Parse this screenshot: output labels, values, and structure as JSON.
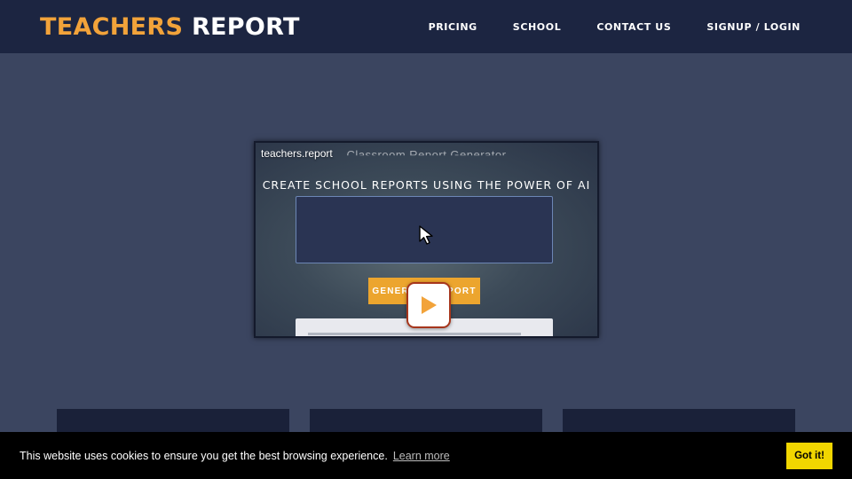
{
  "brand": {
    "part1": "TEACHERS",
    "part2": "REPORT"
  },
  "nav": {
    "items": [
      {
        "label": "PRICING"
      },
      {
        "label": "SCHOOL"
      },
      {
        "label": "CONTACT US"
      },
      {
        "label": "SIGNUP / LOGIN"
      }
    ]
  },
  "video": {
    "title": "teachers.report",
    "heading": "Classroom Report Generator",
    "headline": "CREATE SCHOOL REPORTS USING THE POWER OF AI",
    "button_label": "GENERATE REPORT",
    "icons": [
      "cursor-icon",
      "play-icon"
    ]
  },
  "cookie": {
    "message": "This website uses cookies to ensure you get the best browsing experience.",
    "link": "Learn more",
    "accept": "Got it!"
  },
  "colors": {
    "nav_bg": "#1c2541",
    "page_bg": "#3b4560",
    "accent": "#f2a33a",
    "play_border": "#a6361c",
    "cookie_button": "#f1d600"
  }
}
